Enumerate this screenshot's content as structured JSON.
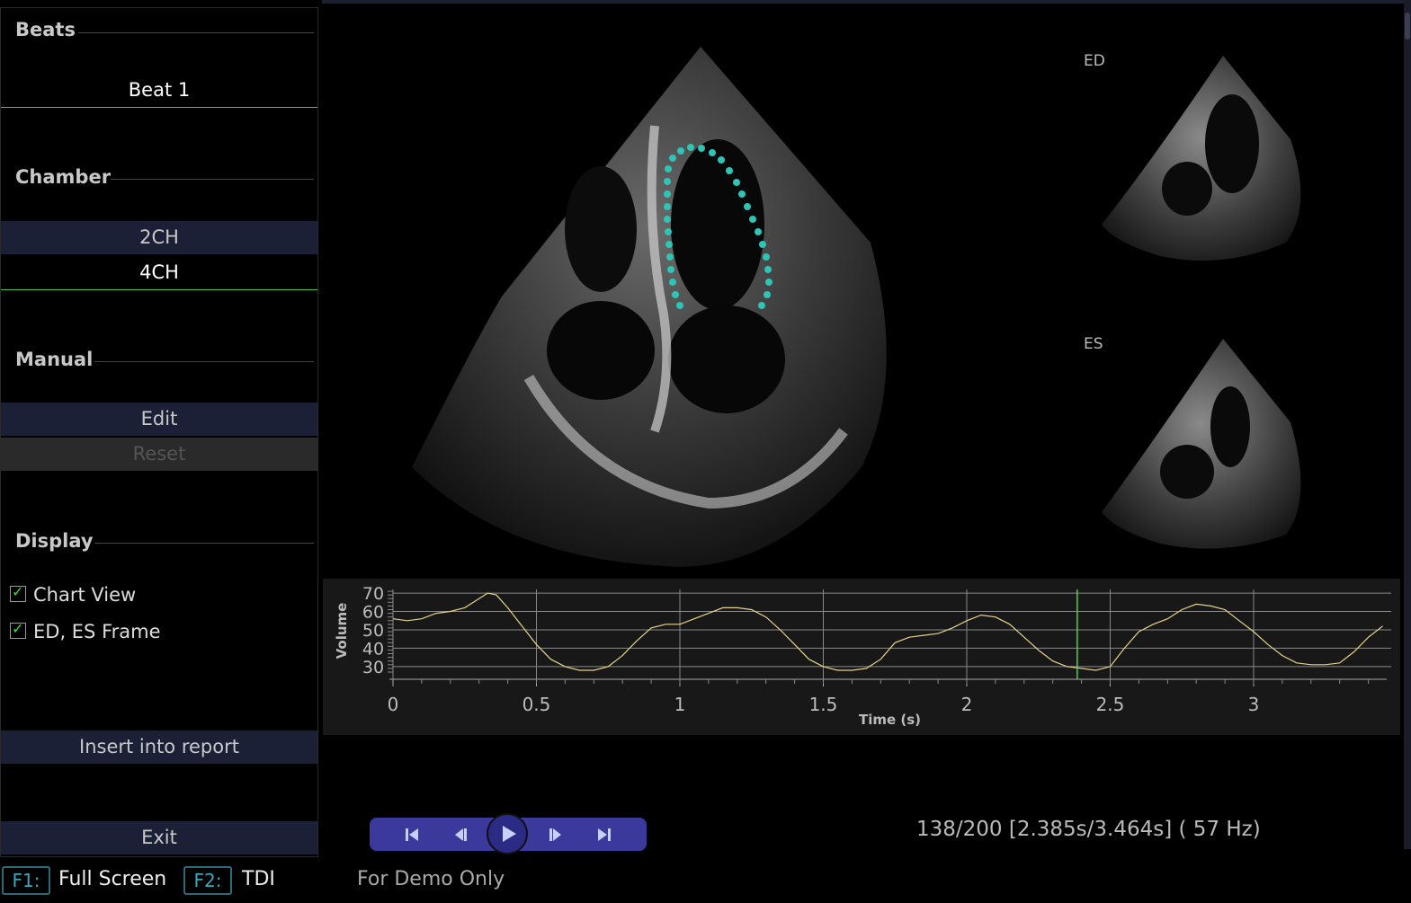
{
  "sidebar": {
    "beats_title": "Beats",
    "beat_1": "Beat 1",
    "chamber_title": "Chamber",
    "chamber_2ch": "2CH",
    "chamber_4ch": "4CH",
    "manual_title": "Manual",
    "edit_label": "Edit",
    "reset_label": "Reset",
    "display_title": "Display",
    "chart_view_label": "Chart View",
    "ed_es_frame_label": "ED, ES Frame",
    "insert_report_label": "Insert into report",
    "exit_label": "Exit"
  },
  "views": {
    "ed_label": "ED",
    "es_label": "ES"
  },
  "player": {
    "frame_info": "138/200 [2.385s/3.464s] ( 57 Hz)"
  },
  "footer": {
    "f1_key": "F1:",
    "f1_label": "Full Screen",
    "f2_key": "F2:",
    "f2_label": "TDI",
    "demo_text": "For Demo Only"
  },
  "colors": {
    "trace": "#2ec4b6",
    "curve": "#e6d28a",
    "cursor": "#3ddc3d",
    "selected_underline": "#4ec24e",
    "play_bar": "#3b3a9c"
  },
  "chart_data": {
    "type": "line",
    "xlabel": "Time (s)",
    "ylabel": "Volume",
    "xlim": [
      0,
      3.464
    ],
    "ylim": [
      27,
      72
    ],
    "xticks": [
      0,
      0.5,
      1,
      1.5,
      2,
      2.5,
      3
    ],
    "yticks": [
      30,
      40,
      50,
      60,
      70
    ],
    "cursor_x": 2.385,
    "series": [
      {
        "x": [
          0,
          0.05,
          0.1,
          0.15,
          0.2,
          0.25,
          0.3,
          0.33,
          0.36,
          0.4,
          0.45,
          0.5,
          0.55,
          0.6,
          0.65,
          0.7,
          0.75,
          0.8,
          0.85,
          0.9,
          0.95,
          1.0,
          1.05,
          1.1,
          1.15,
          1.2,
          1.25,
          1.3,
          1.35,
          1.4,
          1.45,
          1.5,
          1.55,
          1.6,
          1.65,
          1.7,
          1.75,
          1.8,
          1.85,
          1.9,
          1.95,
          2.0,
          2.05,
          2.1,
          2.15,
          2.2,
          2.25,
          2.3,
          2.35,
          2.4,
          2.45,
          2.5,
          2.55,
          2.6,
          2.65,
          2.7,
          2.75,
          2.8,
          2.85,
          2.9,
          2.95,
          3.0,
          3.05,
          3.1,
          3.15,
          3.2,
          3.25,
          3.3,
          3.35,
          3.4,
          3.45
        ],
        "y": [
          56,
          55,
          56,
          59,
          60,
          62,
          67,
          70,
          69,
          62,
          52,
          42,
          34,
          30,
          28,
          28,
          30,
          36,
          44,
          51,
          53,
          53,
          56,
          59,
          62,
          62,
          61,
          57,
          50,
          42,
          34,
          30,
          28,
          28,
          29,
          34,
          43,
          46,
          47,
          48,
          51,
          55,
          58,
          57,
          53,
          46,
          39,
          33,
          30,
          29,
          28,
          30,
          40,
          49,
          53,
          56,
          61,
          64,
          63,
          61,
          55,
          49,
          42,
          36,
          32,
          31,
          31,
          32,
          38,
          46,
          52
        ]
      }
    ]
  }
}
